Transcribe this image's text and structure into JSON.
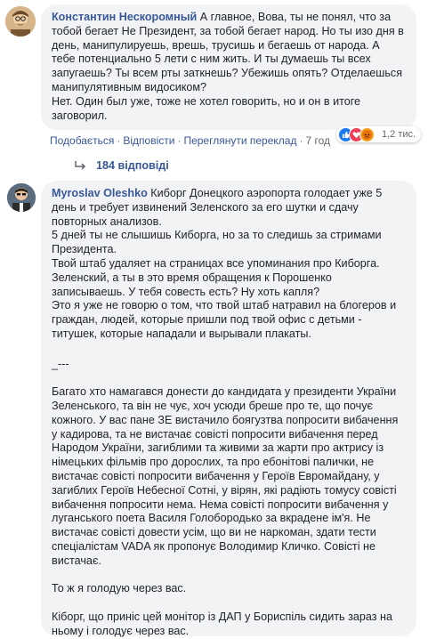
{
  "comment1": {
    "author": "Константин Нескоромный",
    "text": "А главное, Вова, ты не понял, что за тобой бегает Не Президент, за тобой бегает народ. Но ты изо дня в день, манипулируешь, врешь, трусишь и бегаешь от народа. А тебе потенциально 5 лети с ним жить. И ты думаешь ты всех запугаешь? Ты всем рты заткнешь? Убежишь опять? Отделаешься манипулятивным видосиком?",
    "text2": "Нет. Один был уже, тоже не хотел говорить, но и он в итоге заговорил.",
    "actions": {
      "like": "Подобається",
      "reply": "Відповісти",
      "translate": "Переглянути переклад",
      "time": "7 год"
    },
    "reactions": {
      "count": "1,2 тис.",
      "icons": [
        "like-reaction-icon",
        "love-reaction-icon",
        "angry-reaction-icon"
      ],
      "colors": {
        "like": "#1877f2",
        "love": "#f33e58",
        "angry": "#e9710f"
      }
    },
    "replies_label": "184 відповіді"
  },
  "comment2": {
    "author": "Myroslav Oleshko",
    "lines": [
      "Киборг Донецкого аэропорта голодает уже 5 день и требует извинений Зеленского за его шутки и сдачу повторных анализов.",
      "5 дней ты не слышишь Киборга, но за то следишь за стримами Президента.",
      "Твой штаб удаляет на страницах все упоминания про Киборга.",
      "Зеленский, а ты в это время обращения к Порошенко записываешь. У тебя совесть есть? Ну хоть капля?",
      "Это я уже не говорю о том, что твой штаб натравил на блогеров и граждан, людей, которые пришли под твой офис с детьми - титушек, которые нападали и вырывали плакаты."
    ],
    "separator": "_---",
    "ukr_paragraph": "Багато хто намагався донести до кандидата у президенти України Зеленського, та він не чує, хоч усюди бреше про те, що почує кожного. У вас пане ЗЕ вистачило боягузтва попросити вибачення у кадирова, та не вистачає совісті попросити вибачення перед Народом України, загиблими та живими за жарти про актрису із німецьких фільмів про дорослих, та про ебонітові палички, не вистачає совісті попросити вибачення у Героїв Евромайдану, у загиблих Героїв Небесної Сотні, у вірян, які радіють томусу совісті вибачення попросити нема. Нема совісті попросити вибачення у луганського поета Василя Голобородько за вкрадене ім'я. Не вистачає совісті довести усім, що ви не наркоман, здати тести спеціалістам VADA як пропонує Володимир Кличко. Совісті не вистачає.",
    "hunger_line": "То ж я голодую через вас.",
    "monitor_line": "Кіборг, що приніс цей монітор із ДАП у Бориспіль сидить зараз на ньому і голодує через вас."
  }
}
